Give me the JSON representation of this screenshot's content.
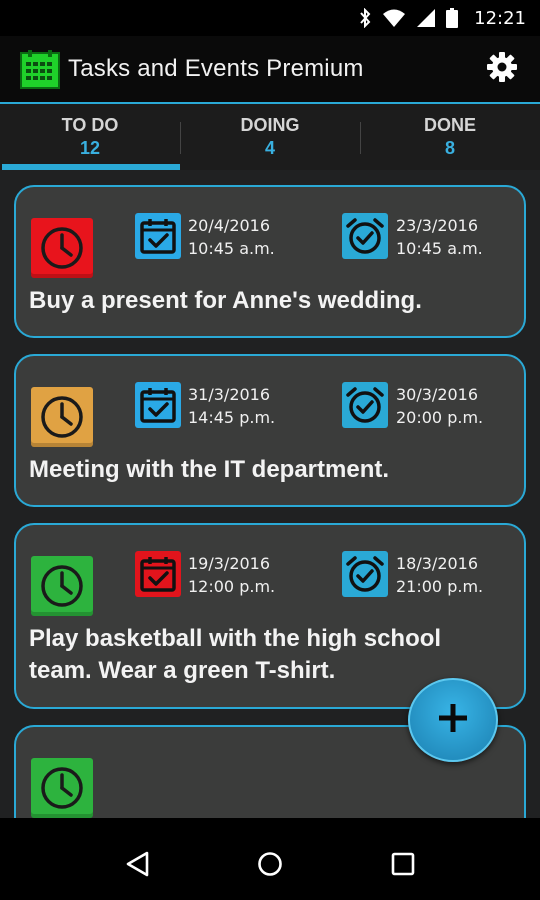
{
  "status_bar": {
    "time": "12:21",
    "icons": [
      "bluetooth-icon",
      "wifi-icon",
      "signal-icon",
      "battery-icon"
    ]
  },
  "app_bar": {
    "title": "Tasks and Events Premium",
    "logo_icon": "calendar-grid-icon",
    "settings_icon": "gear-icon"
  },
  "tabs": [
    {
      "label": "TO DO",
      "count": "12",
      "active": true
    },
    {
      "label": "DOING",
      "count": "4",
      "active": false
    },
    {
      "label": "DONE",
      "count": "8",
      "active": false
    }
  ],
  "tasks": [
    {
      "priority_color": "#e8141c",
      "event_date": "20/4/2016",
      "event_time": "10:45 a.m.",
      "event_icon_color": "#2aa9e6",
      "alarm_date": "23/3/2016",
      "alarm_time": "10:45 a.m.",
      "title": "Buy a present for Anne's wedding."
    },
    {
      "priority_color": "#e0a243",
      "event_date": "31/3/2016",
      "event_time": "14:45 p.m.",
      "event_icon_color": "#2aa9e6",
      "alarm_date": "30/3/2016",
      "alarm_time": "20:00 p.m.",
      "title": "Meeting with the IT department."
    },
    {
      "priority_color": "#2db33e",
      "event_date": "19/3/2016",
      "event_time": "12:00 p.m.",
      "event_icon_color": "#e2141c",
      "alarm_date": "18/3/2016",
      "alarm_time": "21:00 p.m.",
      "title": "Play basketball with the high school team. Wear a green T-shirt."
    },
    {
      "priority_color": "#2db33e",
      "title": ""
    }
  ],
  "fab": {
    "icon": "plus-icon"
  },
  "nav_bar": {
    "icons": [
      "back-icon",
      "home-icon",
      "recents-icon"
    ]
  },
  "colors": {
    "accent": "#2aa9d6",
    "card_bg": "#3b3c3b",
    "list_bg": "#202122"
  }
}
